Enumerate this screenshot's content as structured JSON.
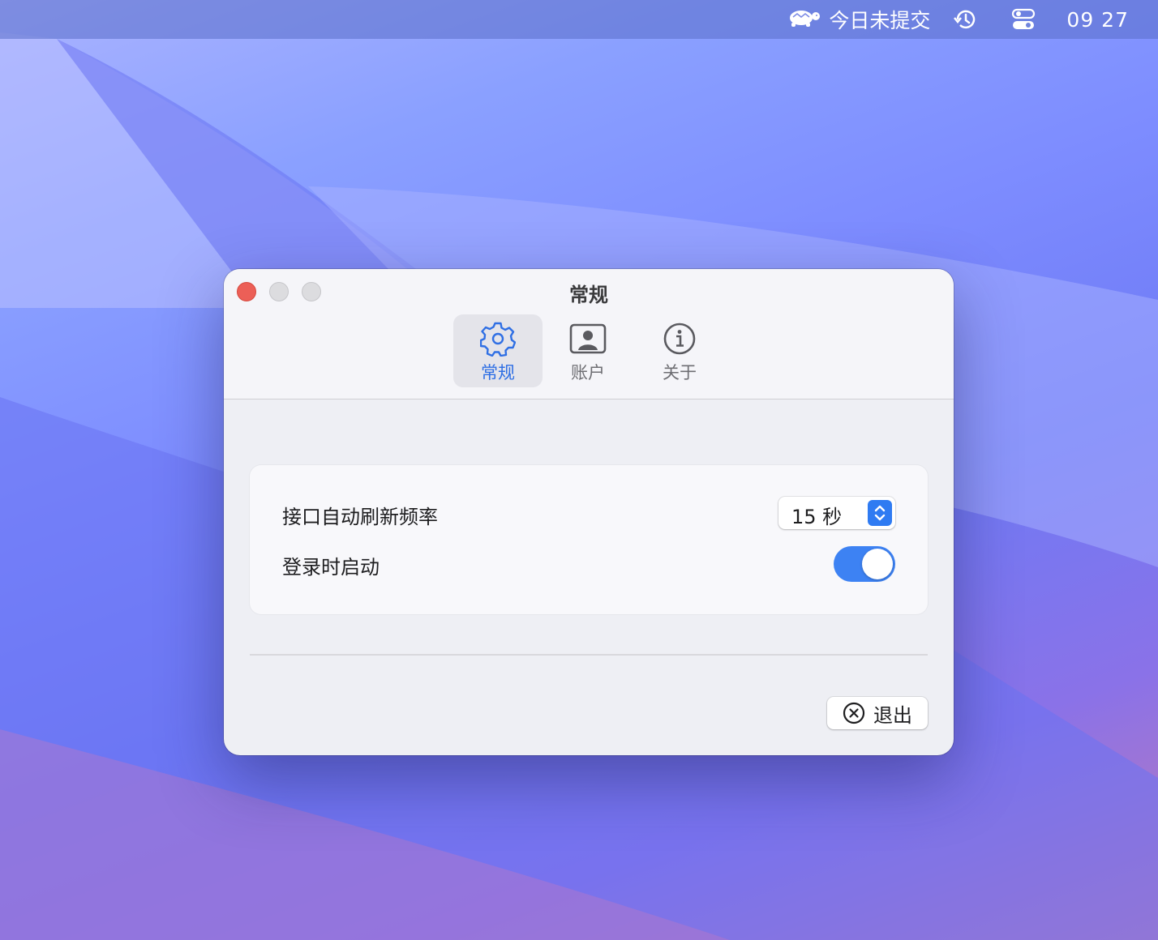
{
  "menubar": {
    "status_text": "今日未提交",
    "clock": "09 27",
    "icons": [
      "turtle-icon",
      "history-clock-icon",
      "control-center-icon"
    ]
  },
  "window": {
    "title": "常规",
    "tabs": [
      {
        "label": "常规",
        "icon": "gear-icon",
        "active": true
      },
      {
        "label": "账户",
        "icon": "person-icon",
        "active": false
      },
      {
        "label": "关于",
        "icon": "info-icon",
        "active": false
      }
    ]
  },
  "settings": {
    "refresh_label": "接口自动刷新频率",
    "refresh_value": "15 秒",
    "launch_label": "登录时启动",
    "launch_enabled": true
  },
  "footer": {
    "quit_label": "退出"
  },
  "colors": {
    "accent": "#2f6fe4",
    "toggle_on": "#3d82f3",
    "close_button": "#ec5f57"
  }
}
